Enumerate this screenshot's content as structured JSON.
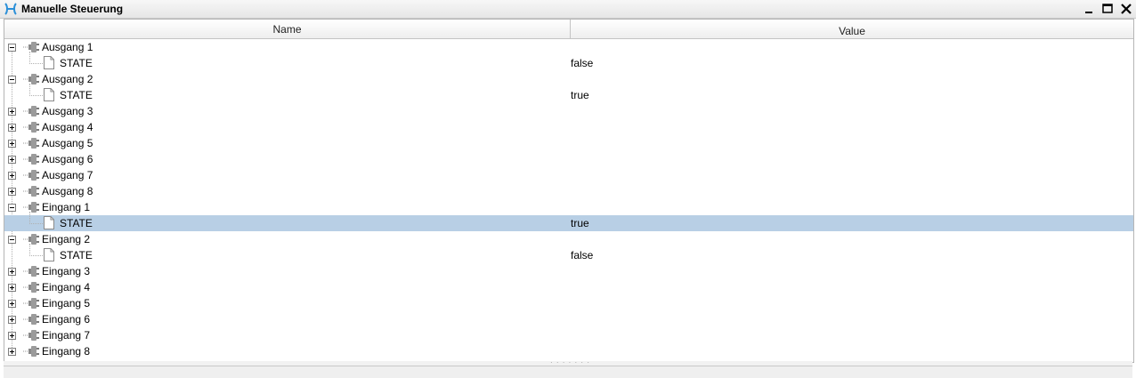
{
  "window": {
    "title": "Manuelle Steuerung",
    "app_icon": "network-h-icon",
    "buttons": [
      "minimize-icon",
      "maximize-icon",
      "close-icon"
    ]
  },
  "table": {
    "columns": {
      "name": "Name",
      "value": "Value"
    },
    "selected_color": "#b8cfe5",
    "rows": [
      {
        "kind": "node",
        "label": "Ausgang 1",
        "expanded": true
      },
      {
        "kind": "leaf",
        "label": "STATE",
        "value": "false"
      },
      {
        "kind": "node",
        "label": "Ausgang 2",
        "expanded": true
      },
      {
        "kind": "leaf",
        "label": "STATE",
        "value": "true"
      },
      {
        "kind": "node",
        "label": "Ausgang 3",
        "expanded": false
      },
      {
        "kind": "node",
        "label": "Ausgang 4",
        "expanded": false
      },
      {
        "kind": "node",
        "label": "Ausgang 5",
        "expanded": false
      },
      {
        "kind": "node",
        "label": "Ausgang 6",
        "expanded": false
      },
      {
        "kind": "node",
        "label": "Ausgang 7",
        "expanded": false
      },
      {
        "kind": "node",
        "label": "Ausgang 8",
        "expanded": false
      },
      {
        "kind": "node",
        "label": "Eingang 1",
        "expanded": true
      },
      {
        "kind": "leaf",
        "label": "STATE",
        "value": "true",
        "selected": true
      },
      {
        "kind": "node",
        "label": "Eingang 2",
        "expanded": true
      },
      {
        "kind": "leaf",
        "label": "STATE",
        "value": "false"
      },
      {
        "kind": "node",
        "label": "Eingang 3",
        "expanded": false
      },
      {
        "kind": "node",
        "label": "Eingang 4",
        "expanded": false
      },
      {
        "kind": "node",
        "label": "Eingang 5",
        "expanded": false
      },
      {
        "kind": "node",
        "label": "Eingang 6",
        "expanded": false
      },
      {
        "kind": "node",
        "label": "Eingang 7",
        "expanded": false
      },
      {
        "kind": "node",
        "label": "Eingang 8",
        "expanded": false
      }
    ]
  }
}
